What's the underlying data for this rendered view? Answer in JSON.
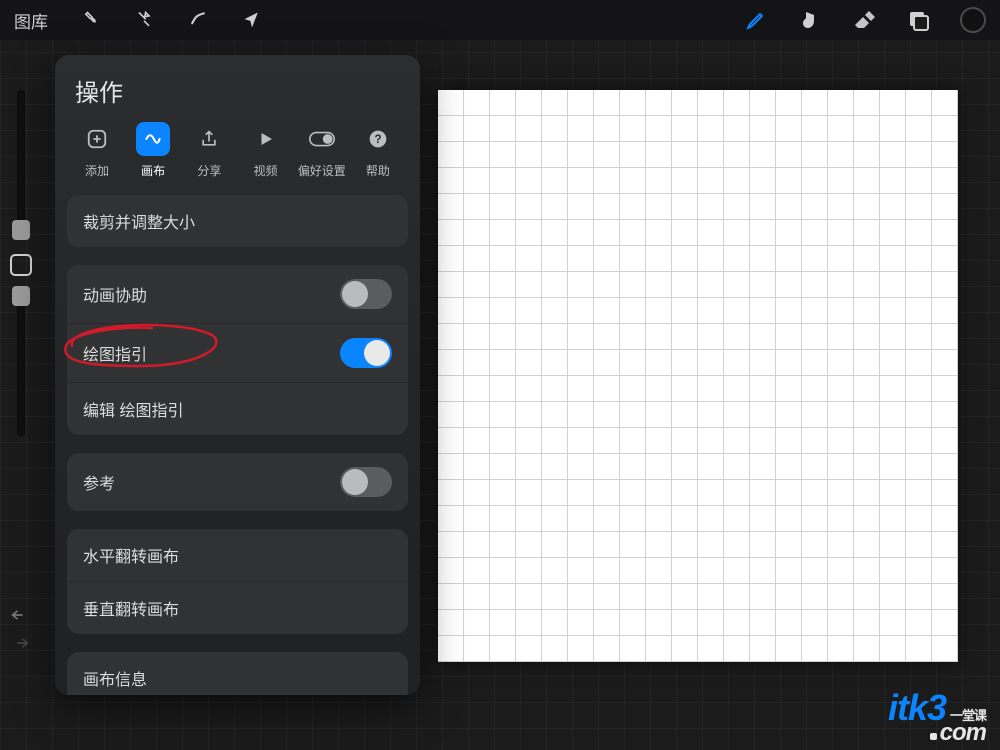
{
  "topbar": {
    "gallery_label": "图库"
  },
  "panel": {
    "title": "操作",
    "tabs": {
      "add": {
        "label": "添加"
      },
      "canvas": {
        "label": "画布"
      },
      "share": {
        "label": "分享"
      },
      "video": {
        "label": "视频"
      },
      "prefs": {
        "label": "偏好设置"
      },
      "help": {
        "label": "帮助"
      }
    },
    "rows": {
      "crop_resize": "裁剪并调整大小",
      "animation_assist": "动画协助",
      "drawing_guide": "绘图指引",
      "edit_drawing_guide": "编辑 绘图指引",
      "reference": "参考",
      "flip_h": "水平翻转画布",
      "flip_v": "垂直翻转画布",
      "canvas_info": "画布信息"
    },
    "toggles": {
      "animation_assist": false,
      "drawing_guide": true,
      "reference": false
    }
  },
  "watermark": {
    "line1_brand": "itk3",
    "line1_tag": "一堂课",
    "line2": "com"
  },
  "colors": {
    "accent": "#0a84ff",
    "annotation": "#d11a2a"
  }
}
